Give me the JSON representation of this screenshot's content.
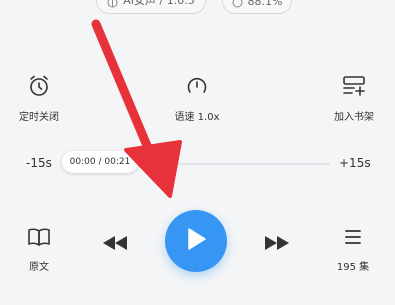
{
  "top_pills": {
    "ai_voice": "AI女声 / 1.0.5",
    "speed": "88.1%"
  },
  "features": {
    "timer_label": "定时关闭",
    "speed_label": "语速 1.0x",
    "shelf_label": "加入书架"
  },
  "progress": {
    "back_label": "-15s",
    "forward_label": "+15s",
    "time_display": "00:00 / 00:21",
    "fraction": 0
  },
  "bottom": {
    "original_label": "原文",
    "episodes_label": "195 集"
  },
  "colors": {
    "play_button": "#3796f3",
    "annotation_arrow": "#e8323b"
  },
  "icons": {
    "timer": "alarm-clock-icon",
    "speed": "speedometer-icon",
    "shelf": "bookshelf-add-icon",
    "original": "open-book-icon",
    "rewind": "rewind-icon",
    "play": "play-icon",
    "forward": "fast-forward-icon",
    "episodes": "list-icon"
  }
}
